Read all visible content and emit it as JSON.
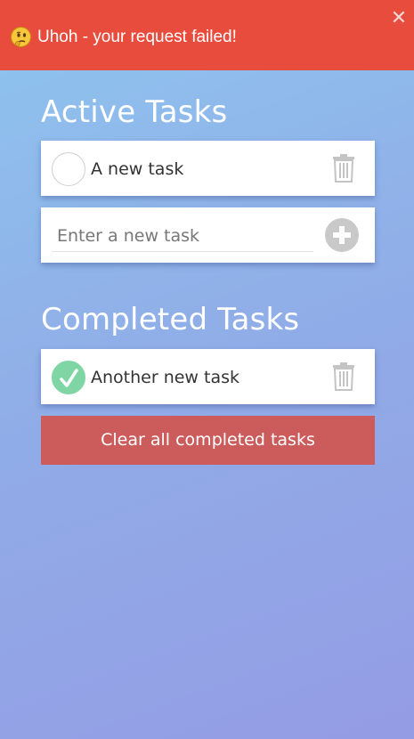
{
  "error_banner": {
    "message": "Uhoh - your request failed!",
    "emoji_icon": "thinking-face-icon",
    "close_icon": "close-icon",
    "background": "#e84c3d"
  },
  "active_section": {
    "title": "Active Tasks",
    "tasks": [
      {
        "label": "A new task",
        "completed": false
      }
    ]
  },
  "new_task": {
    "placeholder": "Enter a new task",
    "value": "",
    "add_icon": "plus-circle-icon"
  },
  "completed_section": {
    "title": "Completed Tasks",
    "tasks": [
      {
        "label": "Another new task",
        "completed": true
      }
    ]
  },
  "clear_button": {
    "label": "Clear all completed tasks",
    "color": "#cc5c5c"
  },
  "colors": {
    "check_done": "#7fd6a4",
    "icon_gray": "#c9c9c9"
  }
}
